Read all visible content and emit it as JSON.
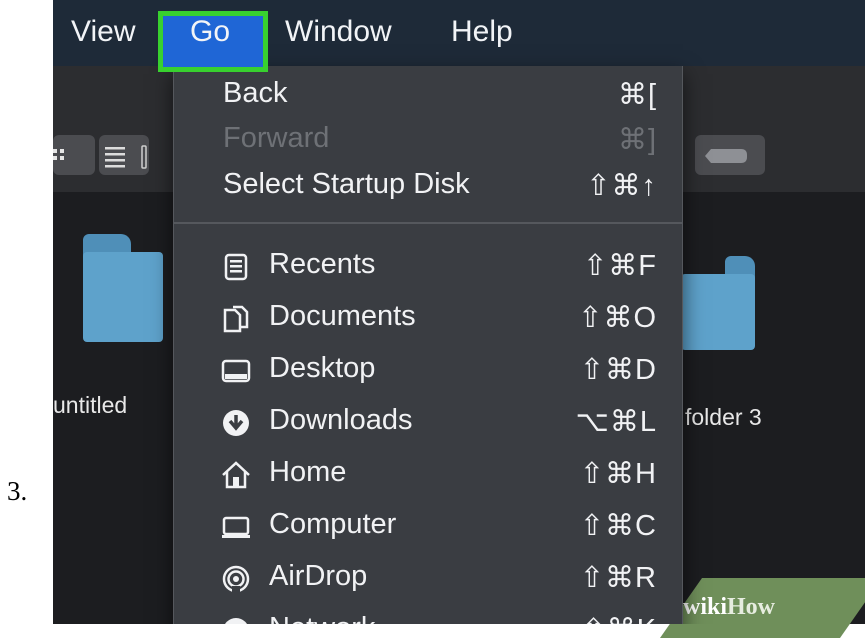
{
  "step_number": "3.",
  "menubar": {
    "items": [
      {
        "label": "View"
      },
      {
        "label": "Go"
      },
      {
        "label": "Window"
      },
      {
        "label": "Help"
      }
    ]
  },
  "files": [
    {
      "label": "untitled"
    },
    {
      "label": "folder 3"
    }
  ],
  "go_menu": {
    "top_items": [
      {
        "label": "Back",
        "shortcut": "⌘[",
        "enabled": true
      },
      {
        "label": "Forward",
        "shortcut": "⌘]",
        "enabled": false
      },
      {
        "label": "Select Startup Disk",
        "shortcut": "⇧⌘↑",
        "enabled": true
      }
    ],
    "places": [
      {
        "label": "Recents",
        "shortcut": "⇧⌘F",
        "icon": "recents-icon"
      },
      {
        "label": "Documents",
        "shortcut": "⇧⌘O",
        "icon": "documents-icon"
      },
      {
        "label": "Desktop",
        "shortcut": "⇧⌘D",
        "icon": "desktop-icon"
      },
      {
        "label": "Downloads",
        "shortcut": "⌥⌘L",
        "icon": "downloads-icon"
      },
      {
        "label": "Home",
        "shortcut": "⇧⌘H",
        "icon": "home-icon"
      },
      {
        "label": "Computer",
        "shortcut": "⇧⌘C",
        "icon": "computer-icon"
      },
      {
        "label": "AirDrop",
        "shortcut": "⇧⌘R",
        "icon": "airdrop-icon"
      },
      {
        "label": "Network",
        "shortcut": "⇧⌘K",
        "icon": "network-icon"
      }
    ]
  },
  "watermark": {
    "wiki": "wiki",
    "how": "How"
  },
  "colors": {
    "highlight_box": "#38d12f",
    "go_selected": "#1f66d6",
    "menu_bg": "#3a3d42",
    "folder": "#5ea2cb"
  }
}
